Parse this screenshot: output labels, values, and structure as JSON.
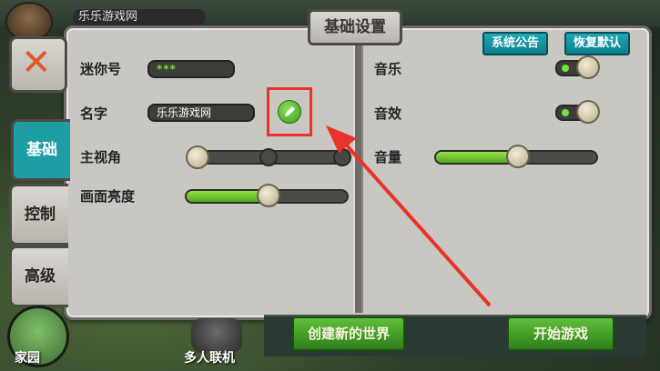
{
  "background": {
    "top_title": "乐乐游戏网"
  },
  "dialog": {
    "title": "基础设置",
    "header_buttons": {
      "announcement": "系统公告",
      "restore_default": "恢复默认"
    },
    "left": {
      "mini_id_label": "迷你号",
      "mini_id_value": "***",
      "name_label": "名字",
      "name_value": "乐乐游戏网",
      "view_label": "主视角",
      "brightness_label": "画面亮度",
      "brightness_level": 0.5
    },
    "right": {
      "music_label": "音乐",
      "sfx_label": "音效",
      "volume_label": "音量",
      "volume_level": 0.5
    }
  },
  "side_tabs": {
    "basic": "基础",
    "control": "控制",
    "advanced": "高级",
    "close_icon": "close-x-icon"
  },
  "bottom": {
    "create_world": "创建新的世界",
    "start_game": "开始游戏",
    "home": "家园",
    "multiplayer": "多人联机"
  },
  "annotation": {
    "color": "#e8322a"
  }
}
